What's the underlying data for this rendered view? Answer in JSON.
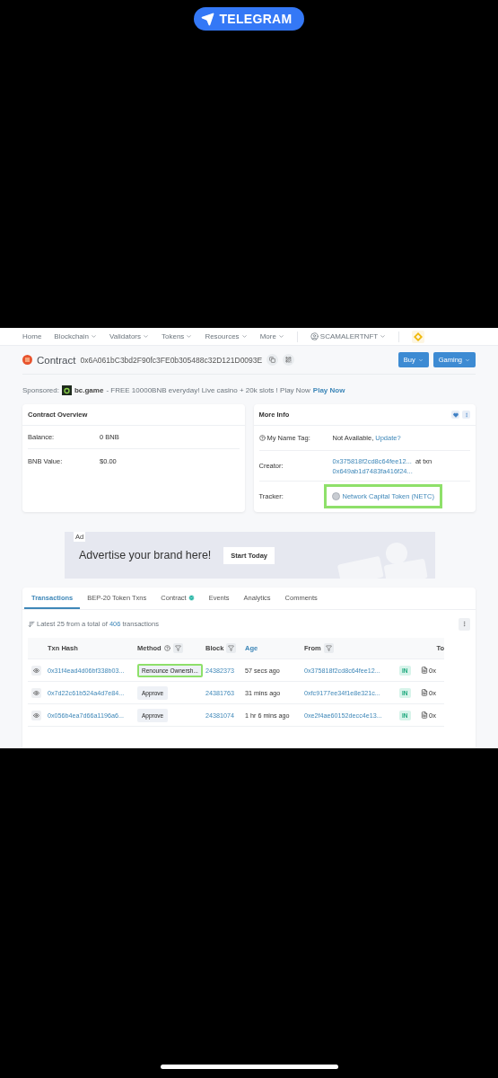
{
  "banner": {
    "label": "TELEGRAM"
  },
  "nav": {
    "items": [
      {
        "label": "Home",
        "dropdown": false
      },
      {
        "label": "Blockchain",
        "dropdown": true
      },
      {
        "label": "Validators",
        "dropdown": true
      },
      {
        "label": "Tokens",
        "dropdown": true
      },
      {
        "label": "Resources",
        "dropdown": true
      },
      {
        "label": "More",
        "dropdown": true
      }
    ],
    "account": "SCAMALERTNFT"
  },
  "contract": {
    "title": "Contract",
    "address": "0x6A061bC3bd2F90fc3FE0b305488c32D121D0093E",
    "buttons": [
      {
        "label": "Buy"
      },
      {
        "label": "Gaming"
      }
    ]
  },
  "sponsored": {
    "label": "Sponsored:",
    "name": "bc.game",
    "text": "- FREE 10000BNB everyday! Live casino + 20k slots ! Play Now",
    "link": "Play Now"
  },
  "overview": {
    "title": "Contract Overview",
    "rows": [
      {
        "label": "Balance:",
        "value": "0 BNB"
      },
      {
        "label": "BNB Value:",
        "value": "$0.00"
      }
    ]
  },
  "more_info": {
    "title": "More Info",
    "name_tag": {
      "label": "My Name Tag:",
      "value": "Not Available,",
      "link": "Update?"
    },
    "creator": {
      "label": "Creator:",
      "address": "0x375818f2cd8c64fee12...",
      "at": "at txn",
      "txn": "0x649ab1d7483fa416f24..."
    },
    "tracker": {
      "label": "Tracker:",
      "value": "Network Capital Token (NETC)",
      "highlighted": true
    }
  },
  "ad": {
    "tag": "Ad",
    "headline": "Advertise your brand here!",
    "button": "Start Today"
  },
  "tabs": [
    {
      "label": "Transactions",
      "selected": true,
      "verified": false
    },
    {
      "label": "BEP-20 Token Txns",
      "selected": false,
      "verified": false
    },
    {
      "label": "Contract",
      "selected": false,
      "verified": true
    },
    {
      "label": "Events",
      "selected": false,
      "verified": false
    },
    {
      "label": "Analytics",
      "selected": false,
      "verified": false
    },
    {
      "label": "Comments",
      "selected": false,
      "verified": false
    }
  ],
  "summary": {
    "prefix": "Latest 25 from a total of",
    "count": "406",
    "suffix": "transactions"
  },
  "table": {
    "columns": [
      {
        "label": "Txn Hash",
        "info": false,
        "filter": false,
        "active": false
      },
      {
        "label": "Method",
        "info": true,
        "filter": true,
        "active": false
      },
      {
        "label": "Block",
        "info": false,
        "filter": true,
        "active": false
      },
      {
        "label": "Age",
        "info": false,
        "filter": false,
        "active": true
      },
      {
        "label": "From",
        "info": false,
        "filter": true,
        "active": false
      },
      {
        "label": "To",
        "info": false,
        "filter": false,
        "active": false
      }
    ],
    "rows": [
      {
        "hash": "0x31f4ead4d06bf338b03...",
        "method": "Renounce Ownersh...",
        "highlighted": true,
        "block": "24382373",
        "age": "57 secs ago",
        "from": "0x375818f2cd8c64fee12...",
        "direction": "IN",
        "to": "0x"
      },
      {
        "hash": "0x7d22c61b524a4d7e84...",
        "method": "Approve",
        "highlighted": false,
        "block": "24381763",
        "age": "31 mins ago",
        "from": "0xfc9177ee34f1e8e321c...",
        "direction": "IN",
        "to": "0x"
      },
      {
        "hash": "0x056b4ea7d66a1196a6...",
        "method": "Approve",
        "highlighted": false,
        "block": "24381074",
        "age": "1 hr 6 mins ago",
        "from": "0xe2f4ae60152decc4e13...",
        "direction": "IN",
        "to": "0x"
      }
    ]
  }
}
